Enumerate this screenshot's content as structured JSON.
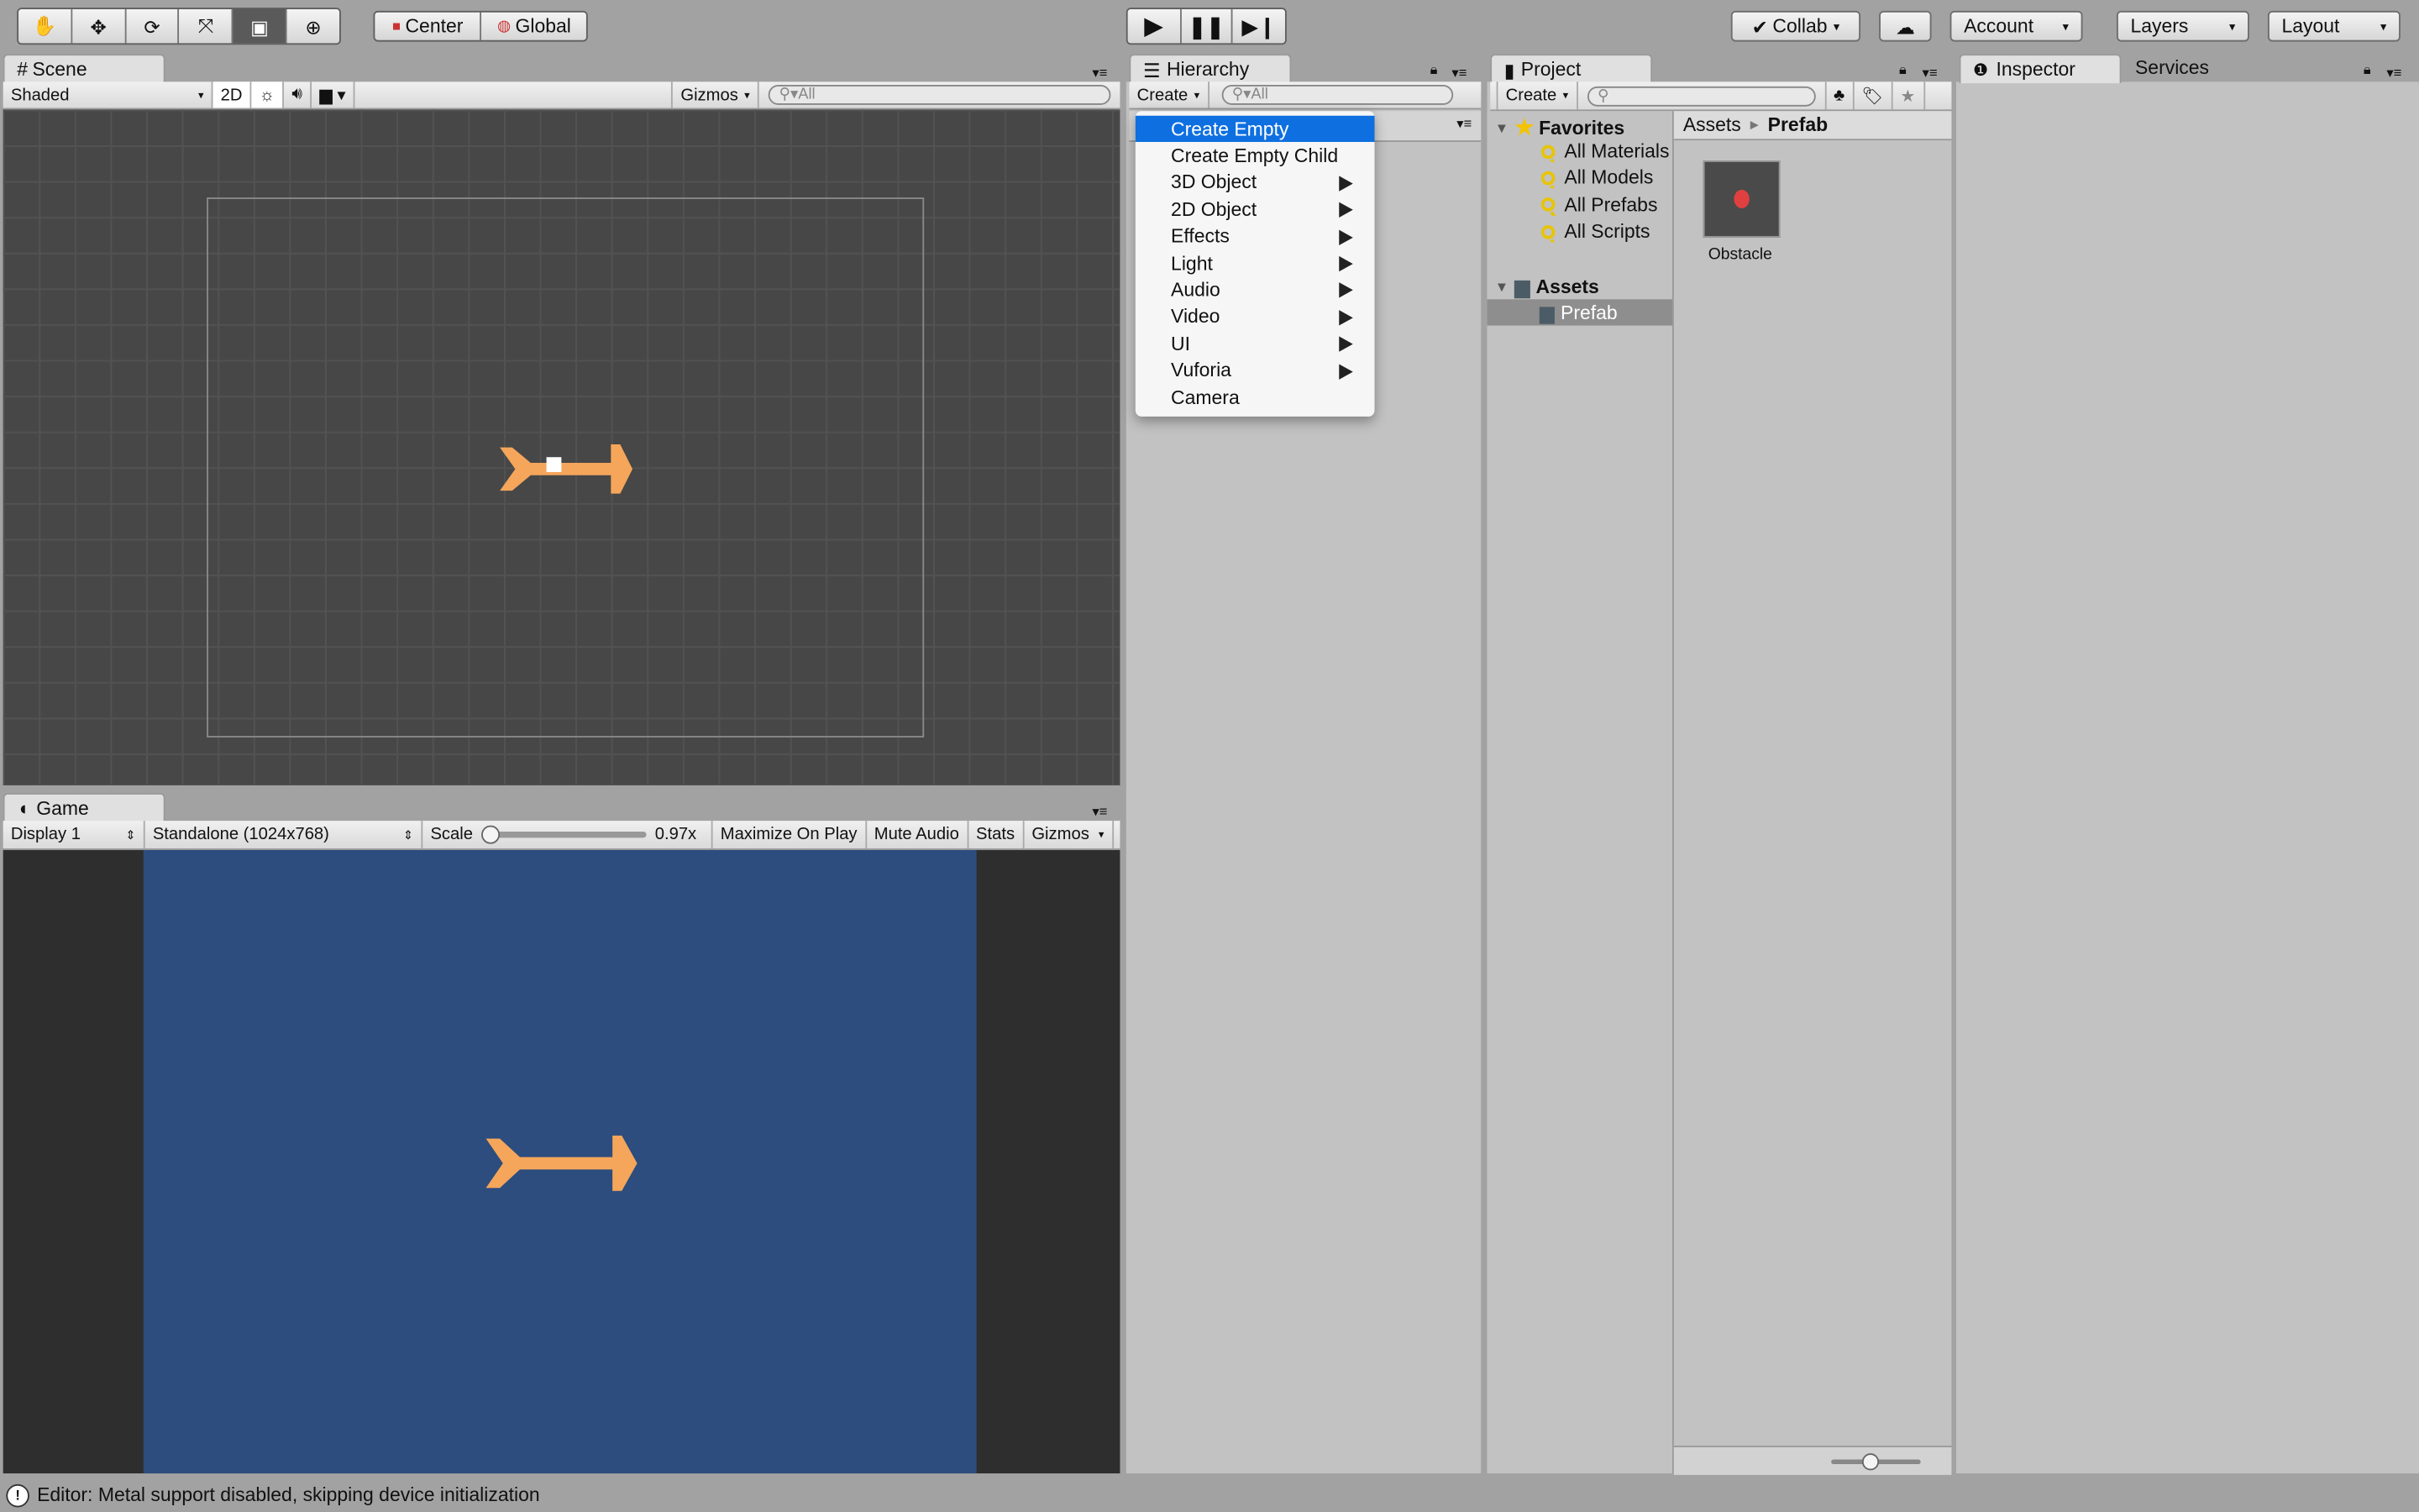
{
  "toolbar": {
    "tools": [
      "hand-tool",
      "move-tool",
      "rotate-tool",
      "scale-tool",
      "rect-tool",
      "transform-tool"
    ],
    "active_tool": "rect-tool",
    "pivot": "Center",
    "space": "Global",
    "play_controls": [
      "play",
      "pause",
      "step"
    ],
    "collab": "Collab",
    "account": "Account",
    "layers": "Layers",
    "layout": "Layout"
  },
  "scene": {
    "tab": "Scene",
    "shading": "Shaded",
    "mode_2d": "2D",
    "gizmos": "Gizmos",
    "search_placeholder": "All"
  },
  "game": {
    "tab": "Game",
    "display": "Display 1",
    "resolution": "Standalone (1024x768)",
    "scale_label": "Scale",
    "scale_value": "0.97x",
    "scale_fraction": 0.0,
    "maximize": "Maximize On Play",
    "mute": "Mute Audio",
    "stats": "Stats",
    "gizmos": "Gizmos",
    "background": "#2c4d7e"
  },
  "hierarchy": {
    "tab": "Hierarchy",
    "create": "Create",
    "search_placeholder": "All",
    "menu": [
      {
        "label": "Create Empty",
        "submenu": false,
        "selected": true
      },
      {
        "label": "Create Empty Child",
        "submenu": false
      },
      {
        "label": "3D Object",
        "submenu": true
      },
      {
        "label": "2D Object",
        "submenu": true
      },
      {
        "label": "Effects",
        "submenu": true
      },
      {
        "label": "Light",
        "submenu": true
      },
      {
        "label": "Audio",
        "submenu": true
      },
      {
        "label": "Video",
        "submenu": true
      },
      {
        "label": "UI",
        "submenu": true
      },
      {
        "label": "Vuforia",
        "submenu": true
      },
      {
        "label": "Camera",
        "submenu": false
      }
    ]
  },
  "project": {
    "tab": "Project",
    "create": "Create",
    "favorites": {
      "label": "Favorites",
      "items": [
        "All Materials",
        "All Models",
        "All Prefabs",
        "All Scripts"
      ]
    },
    "assets": {
      "label": "Assets",
      "children": [
        "Prefab"
      ]
    },
    "breadcrumb": [
      "Assets",
      "Prefab"
    ],
    "files": [
      {
        "name": "Obstacle"
      }
    ]
  },
  "inspector": {
    "tab": "Inspector",
    "services_tab": "Services"
  },
  "status": {
    "message": "Editor: Metal support disabled, skipping device initialization"
  },
  "colors": {
    "accent": "#0e6fe0",
    "sprite": "#f5a65b"
  }
}
